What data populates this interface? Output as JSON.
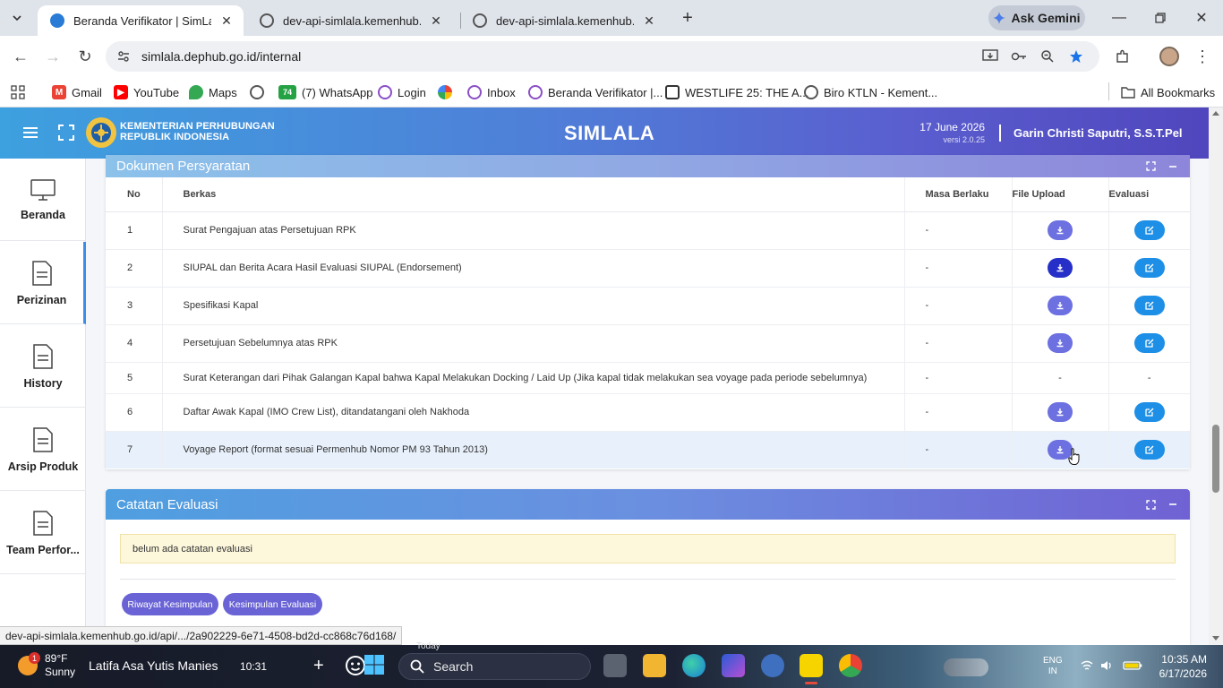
{
  "browser": {
    "tabs": [
      {
        "title": "Beranda Verifikator | SimLala",
        "active": true
      },
      {
        "title": "dev-api-simlala.kemenhub.go.id",
        "active": false
      },
      {
        "title": "dev-api-simlala.kemenhub.go.id",
        "active": false
      }
    ],
    "ask_gemini": "Ask Gemini",
    "url": "simlala.dephub.go.id/internal",
    "bookmarks": [
      {
        "label": "Gmail"
      },
      {
        "label": "YouTube"
      },
      {
        "label": "Maps"
      },
      {
        "label": ""
      },
      {
        "label": "(7) WhatsApp",
        "badge": "74"
      },
      {
        "label": "Login"
      },
      {
        "label": ""
      },
      {
        "label": "Inbox"
      },
      {
        "label": "Beranda Verifikator |..."
      },
      {
        "label": "WESTLIFE 25: THE A..."
      },
      {
        "label": "Biro KTLN - Kement..."
      }
    ],
    "all_bookmarks": "All Bookmarks",
    "status_link": "dev-api-simlala.kemenhub.go.id/api/.../2a902229-6e71-4508-bd2d-cc868c76d168/"
  },
  "header": {
    "org_line1": "KEMENTERIAN PERHUBUNGAN",
    "org_line2": "REPUBLIK INDONESIA",
    "app_title": "SIMLALA",
    "date": "17 June 2026",
    "version": "versi 2.0.25",
    "user": "Garin Christi Saputri, S.S.T.Pel"
  },
  "sidebar": {
    "items": [
      {
        "label": "Beranda",
        "icon": "monitor-icon"
      },
      {
        "label": "Perizinan",
        "icon": "document-icon",
        "active": true
      },
      {
        "label": "History",
        "icon": "document-icon"
      },
      {
        "label": "Arsip Produk",
        "icon": "document-icon"
      },
      {
        "label": "Team Perfor...",
        "icon": "document-icon"
      }
    ]
  },
  "documents": {
    "title": "Dokumen Persyaratan",
    "columns": {
      "no": "No",
      "berkas": "Berkas",
      "masa": "Masa Berlaku",
      "file": "File Upload",
      "eval": "Evaluasi"
    },
    "rows": [
      {
        "no": "1",
        "berkas": "Surat Pengajuan atas Persetujuan RPK",
        "masa": "-",
        "file": true,
        "eval": true
      },
      {
        "no": "2",
        "berkas": "SIUPAL dan Berita Acara Hasil Evaluasi SIUPAL (Endorsement)",
        "masa": "-",
        "file": true,
        "eval": true
      },
      {
        "no": "3",
        "berkas": "Spesifikasi Kapal",
        "masa": "-",
        "file": true,
        "eval": true
      },
      {
        "no": "4",
        "berkas": "Persetujuan Sebelumnya atas RPK",
        "masa": "-",
        "file": true,
        "eval": true
      },
      {
        "no": "5",
        "berkas": "Surat Keterangan dari Pihak Galangan Kapal bahwa Kapal Melakukan Docking / Laid Up (Jika kapal tidak melakukan sea voyage pada periode sebelumnya)",
        "masa": "-",
        "file": false,
        "eval": false,
        "file_text": "-",
        "eval_text": "-"
      },
      {
        "no": "6",
        "berkas": "Daftar Awak Kapal (IMO Crew List), ditandatangani oleh Nakhoda",
        "masa": "-",
        "file": true,
        "eval": true
      },
      {
        "no": "7",
        "berkas": "Voyage Report (format sesuai Permenhub Nomor PM 93 Tahun 2013)",
        "masa": "-",
        "file": true,
        "eval": true
      }
    ]
  },
  "evaluation": {
    "title": "Catatan Evaluasi",
    "note": "belum ada catatan evaluasi",
    "btn_history": "Riwayat Kesimpulan",
    "btn_conclusion": "Kesimpulan Evaluasi"
  },
  "taskbar": {
    "temp": "89°F",
    "weather": "Sunny",
    "weather_badge": "1",
    "news": "Latifa Asa Yutis Manies",
    "news_time": "10:31",
    "today": "Today",
    "search": "Search",
    "lang1": "ENG",
    "lang2": "IN",
    "time": "10:35 AM",
    "date": "6/17/2026"
  },
  "colors": {
    "header_start": "#3da0df",
    "header_end": "#5046bd",
    "download_btn": "#6c70e0",
    "download_btn_active": "#2630c8",
    "edit_btn": "#1e8fe6",
    "pill_btn": "#6a63d6"
  }
}
